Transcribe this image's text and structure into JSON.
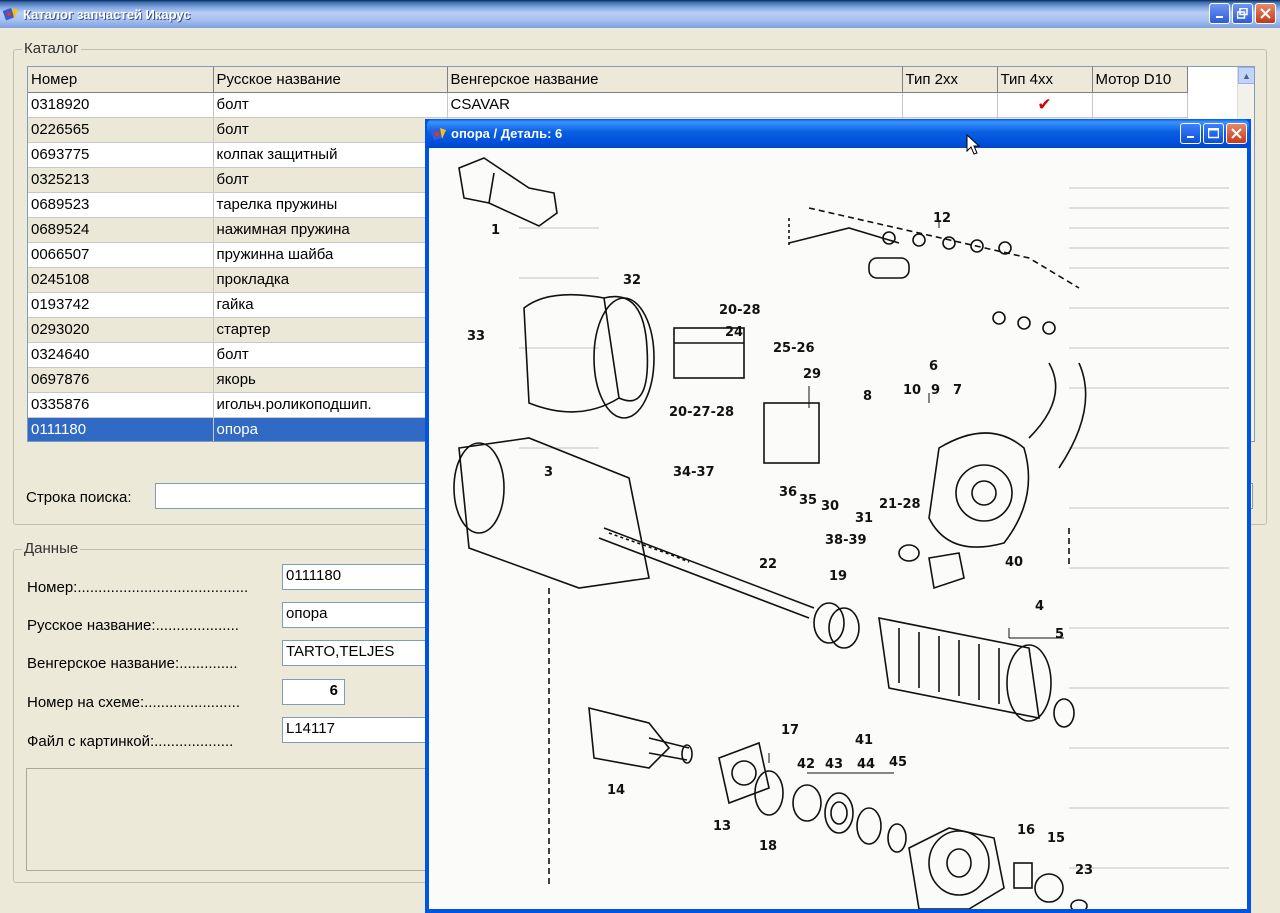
{
  "window": {
    "title": "Каталог запчастей Икарус"
  },
  "catalog": {
    "legend": "Каталог",
    "columns": [
      "Номер",
      "Русское название",
      "Венгерское название",
      "Тип 2xx",
      "Тип 4xx",
      "Мотор D10"
    ],
    "rows": [
      {
        "num": "0318920",
        "ru": "болт",
        "hu": "CSAVAR",
        "t2": "",
        "t4": "✔",
        "d10": ""
      },
      {
        "num": "0226565",
        "ru": "болт",
        "hu": "",
        "t2": "",
        "t4": "",
        "d10": ""
      },
      {
        "num": "0693775",
        "ru": "колпак защитный",
        "hu": "",
        "t2": "",
        "t4": "",
        "d10": ""
      },
      {
        "num": "0325213",
        "ru": "болт",
        "hu": "",
        "t2": "",
        "t4": "",
        "d10": ""
      },
      {
        "num": "0689523",
        "ru": "тарелка пружины",
        "hu": "",
        "t2": "",
        "t4": "",
        "d10": ""
      },
      {
        "num": "0689524",
        "ru": "нажимная пружина",
        "hu": "",
        "t2": "",
        "t4": "",
        "d10": ""
      },
      {
        "num": "0066507",
        "ru": "пружинна шайба",
        "hu": "",
        "t2": "",
        "t4": "",
        "d10": ""
      },
      {
        "num": "0245108",
        "ru": "прокладка",
        "hu": "",
        "t2": "",
        "t4": "",
        "d10": ""
      },
      {
        "num": "0193742",
        "ru": "гайка",
        "hu": "",
        "t2": "",
        "t4": "",
        "d10": ""
      },
      {
        "num": "0293020",
        "ru": "стартер",
        "hu": "",
        "t2": "",
        "t4": "",
        "d10": ""
      },
      {
        "num": "0324640",
        "ru": "болт",
        "hu": "",
        "t2": "",
        "t4": "",
        "d10": ""
      },
      {
        "num": "0697876",
        "ru": "якорь",
        "hu": "",
        "t2": "",
        "t4": "",
        "d10": ""
      },
      {
        "num": "0335876",
        "ru": "игольч.роликоподшип.",
        "hu": "",
        "t2": "",
        "t4": "",
        "d10": ""
      },
      {
        "num": "0111180",
        "ru": "опора",
        "hu": "",
        "t2": "",
        "t4": "",
        "d10": ""
      }
    ],
    "search_label": "Строка поиска:",
    "search_value": ""
  },
  "data": {
    "legend": "Данные",
    "labels": {
      "number": "Номер:.........................................",
      "ru_name": "Русское название:....................",
      "hu_name": "Венгерское название:..............",
      "scheme_num": "Номер на схеме:.......................",
      "image_file": "Файл с картинкой:..................."
    },
    "values": {
      "number": "0111180",
      "ru_name": "опора",
      "hu_name": "TARTO,TELJES",
      "scheme_num": "6",
      "image_file": "L14117"
    }
  },
  "child_window": {
    "title": "опора / Деталь: 6",
    "callouts": [
      "1",
      "12",
      "32",
      "20-28",
      "24",
      "33",
      "25-26",
      "29",
      "6",
      "8",
      "10",
      "9",
      "7",
      "20-27-28",
      "34-37",
      "36",
      "35",
      "30",
      "31",
      "21-28",
      "3",
      "38-39",
      "40",
      "22",
      "19",
      "4",
      "5",
      "17",
      "41",
      "42",
      "43",
      "44",
      "45",
      "14",
      "13",
      "18",
      "16",
      "15",
      "23"
    ]
  },
  "colors": {
    "selection": "#316ac5",
    "check": "#d40000",
    "xp_blue": "#0054e3"
  }
}
